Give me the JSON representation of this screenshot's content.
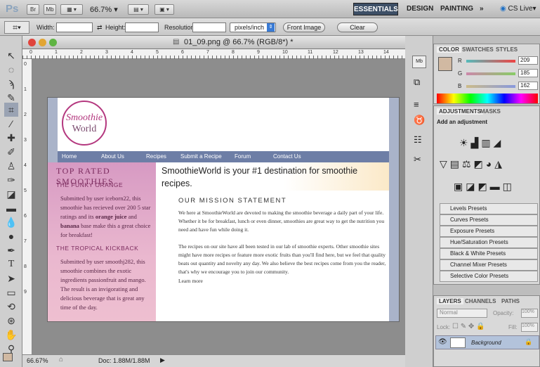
{
  "app": {
    "logo": "Ps",
    "br": "Br",
    "mb": "Mb",
    "zoom": "66.7%",
    "workspaces": [
      "ESSENTIALS",
      "DESIGN",
      "PAINTING"
    ],
    "more": "»",
    "cslive": "CS Live"
  },
  "options": {
    "width_label": "Width:",
    "height_label": "Height:",
    "resolution_label": "Resolution:",
    "units": "pixels/inch",
    "front_image": "Front Image",
    "clear": "Clear"
  },
  "document": {
    "title": "01_09.png @ 66.7% (RGB/8*) *",
    "ruler_h": [
      "0",
      "1",
      "2",
      "3",
      "4",
      "5",
      "6",
      "7",
      "8",
      "9",
      "10",
      "11",
      "12",
      "13",
      "14"
    ],
    "ruler_v": [
      "0",
      "1",
      "2",
      "3",
      "4",
      "5",
      "6",
      "7",
      "8",
      "9"
    ],
    "status_zoom": "66.67%",
    "status_doc": "Doc: 1.88M/1.88M"
  },
  "website": {
    "logo_line1": "Smoothie",
    "logo_line2": "World",
    "nav": [
      "Home",
      "About Us",
      "Recipes",
      "Submit a Recipe",
      "Forum",
      "Contact Us"
    ],
    "left_heading": "TOP RATED SMOOTHIES",
    "item1_title": "THE FUNKY ORANGE",
    "item1_text_a": "Submitted by user iceborn22, this smoothie has recieved over 200 5 star ratings and its ",
    "item1_bold1": "orange juice",
    "item1_text_b": " and ",
    "item1_bold2": "banana",
    "item1_text_c": " base make this a great choice for breakfast!",
    "item2_title": "THE TROPICAL KICKBACK",
    "item2_text": "Submitted by user smoothj282, this smoothie combines the exotic ingredients passionfruit and mango. The result is an invigorating and delicious beverage that is great any time of the day.",
    "hero": "SmoothieWorld is your #1 destination for smoothie recipes.",
    "mission_heading": "OUR MISSION STATEMENT",
    "para1": "We here at SmoothieWorld are devoted to making the smoothie beverage a daily part of your life. Whether it be for breakfast, lunch or even dinner, smoothies are great way to get the nutrition you need and have fun while doing it.",
    "para2": "The recipes on our site have all been tested in our lab of smoothie experts. Other smoothie sites might have more recipes or feature more exotic fruits than you'll find here, but we feel that quality beats out quantity and novelty any day. We also believe the best recipes come from you the reader, that's why we encourage you to join our community.",
    "learn_more": "Learn more"
  },
  "color_panel": {
    "tabs": [
      "COLOR",
      "SWATCHES",
      "STYLES"
    ],
    "r_label": "R",
    "g_label": "G",
    "b_label": "B",
    "r": "209",
    "g": "185",
    "b": "162",
    "r_fraction": 0.82,
    "g_fraction": 0.73,
    "b_fraction": 0.64,
    "swatch": "#d1b9a2"
  },
  "adjustments": {
    "tabs": [
      "ADJUSTMENTS",
      "MASKS"
    ],
    "title": "Add an adjustment",
    "presets": [
      "Levels Presets",
      "Curves Presets",
      "Exposure Presets",
      "Hue/Saturation Presets",
      "Black & White Presets",
      "Channel Mixer Presets",
      "Selective Color Presets"
    ]
  },
  "layers": {
    "tabs": [
      "LAYERS",
      "CHANNELS",
      "PATHS"
    ],
    "blend": "Normal",
    "opacity_label": "Opacity:",
    "opacity": "100%",
    "lock_label": "Lock:",
    "fill_label": "Fill:",
    "fill": "100%",
    "layer_name": "Background"
  }
}
